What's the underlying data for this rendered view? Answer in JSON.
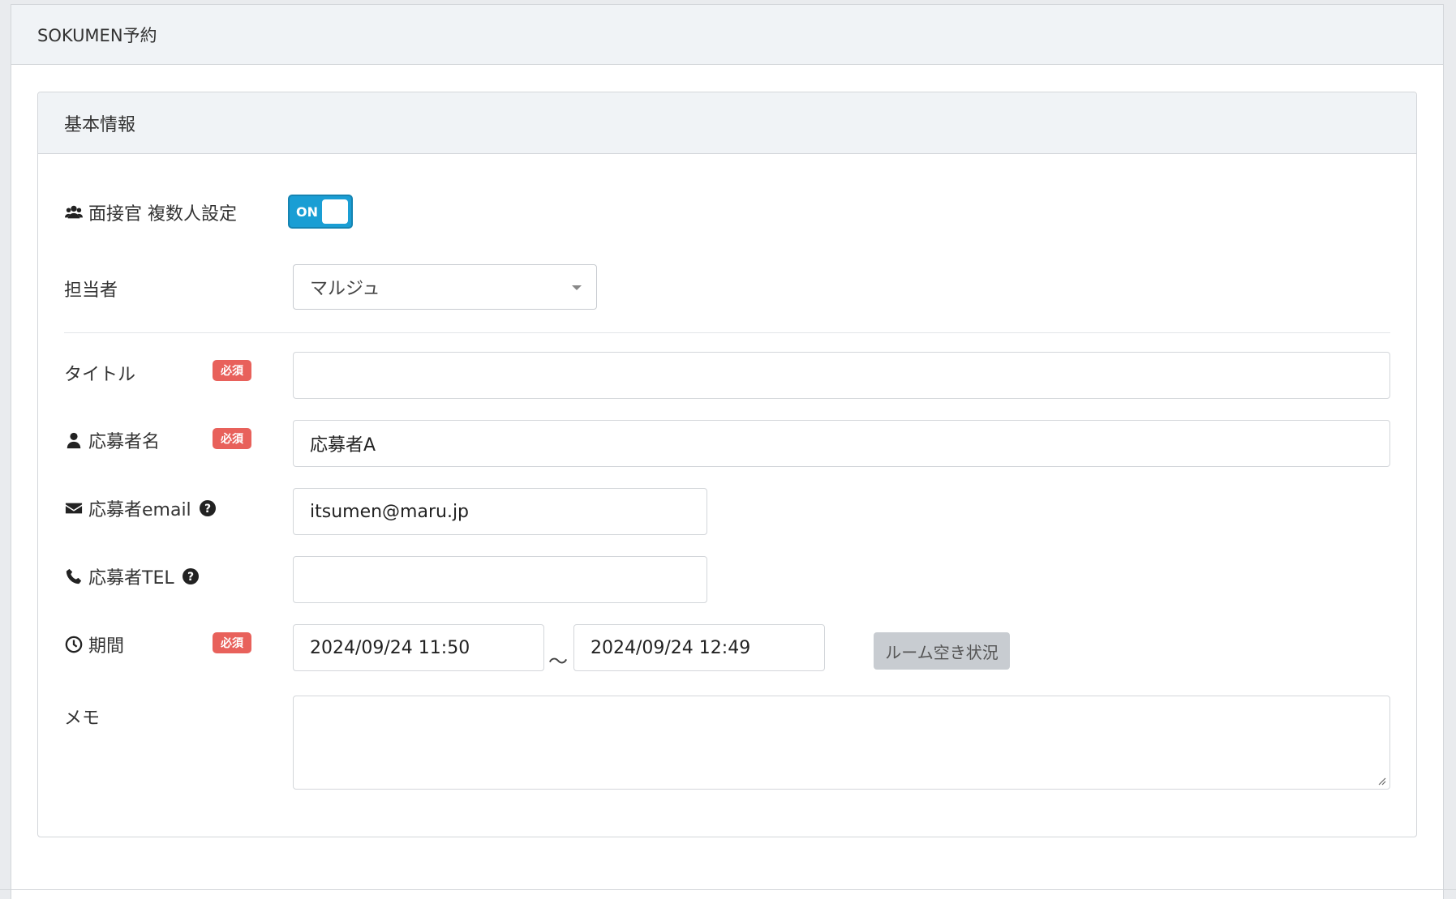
{
  "page": {
    "title": "SOKUMEN予約"
  },
  "section": {
    "title": "基本情報"
  },
  "multi_interviewer": {
    "label": "面接官 複数人設定",
    "toggle_text": "ON"
  },
  "assignee": {
    "label": "担当者",
    "value": "マルジュ"
  },
  "required_badge": "必須",
  "title_field": {
    "label": "タイトル",
    "value": ""
  },
  "applicant_name": {
    "label": "応募者名",
    "value": "応募者A"
  },
  "applicant_email": {
    "label": "応募者email",
    "value": "itsumen@maru.jp"
  },
  "applicant_tel": {
    "label": "応募者TEL",
    "value": ""
  },
  "period": {
    "label": "期間",
    "start": "2024/09/24 11:50",
    "separator": "〜",
    "end": "2024/09/24 12:49",
    "room_button": "ルーム空き状況"
  },
  "memo": {
    "label": "メモ",
    "value": ""
  },
  "colors": {
    "toggle": "#1a9ed4",
    "required": "#e8615b",
    "button": "#c8ccd1"
  }
}
